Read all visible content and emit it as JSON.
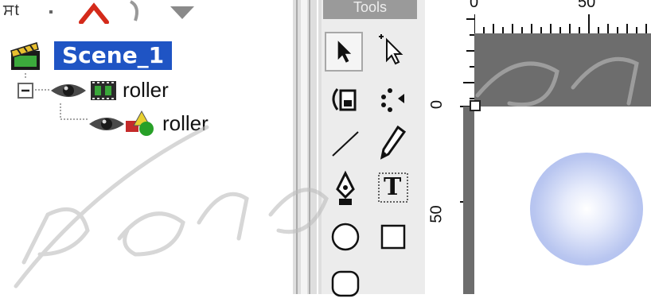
{
  "toolbar": {
    "partial_text": "ਸt",
    "icons": [
      "close-icon",
      "redo-icon",
      "dropdown-arrow-icon"
    ]
  },
  "tree": {
    "scene": {
      "label": "Scene_1",
      "icon": "scene-clapper-icon"
    },
    "layers": [
      {
        "label": "roller",
        "icons": [
          "collapse-icon",
          "eye-icon",
          "film-strip-icon"
        ]
      },
      {
        "label": "roller",
        "icons": [
          "eye-icon",
          "shapes-icon"
        ]
      }
    ]
  },
  "tools": {
    "header": "Tools",
    "items": [
      {
        "name": "arrow-tool-button",
        "icon": "arrow-icon",
        "selected": true
      },
      {
        "name": "subselect-tool-button",
        "icon": "subselect-icon"
      },
      {
        "name": "free-transform-tool-button",
        "icon": "free-transform-icon"
      },
      {
        "name": "lasso-tool-button",
        "icon": "lasso-icon"
      },
      {
        "name": "line-tool-button",
        "icon": "line-icon"
      },
      {
        "name": "pencil-tool-button",
        "icon": "pencil-icon"
      },
      {
        "name": "pen-tool-button",
        "icon": "pen-icon"
      },
      {
        "name": "text-tool-button",
        "icon": "text-icon",
        "glyph": "T"
      },
      {
        "name": "oval-tool-button",
        "icon": "oval-icon"
      },
      {
        "name": "rectangle-tool-button",
        "icon": "rectangle-icon"
      },
      {
        "name": "rounded-rectangle-tool-button",
        "icon": "rounded-rectangle-icon"
      }
    ]
  },
  "rulers": {
    "horizontal_labels": [
      "0",
      "50"
    ],
    "vertical_labels": [
      "0",
      "50"
    ]
  },
  "stage": {
    "object": "gradient-circle",
    "colors": {
      "center": "#ffffff",
      "edge": "#a3b5ec",
      "band": "#6d6d6d"
    }
  },
  "watermark": {
    "text": "parsa"
  },
  "colors": {
    "selection": "#1f54c4",
    "panel": "#ececec",
    "splitter": "#dedede"
  }
}
